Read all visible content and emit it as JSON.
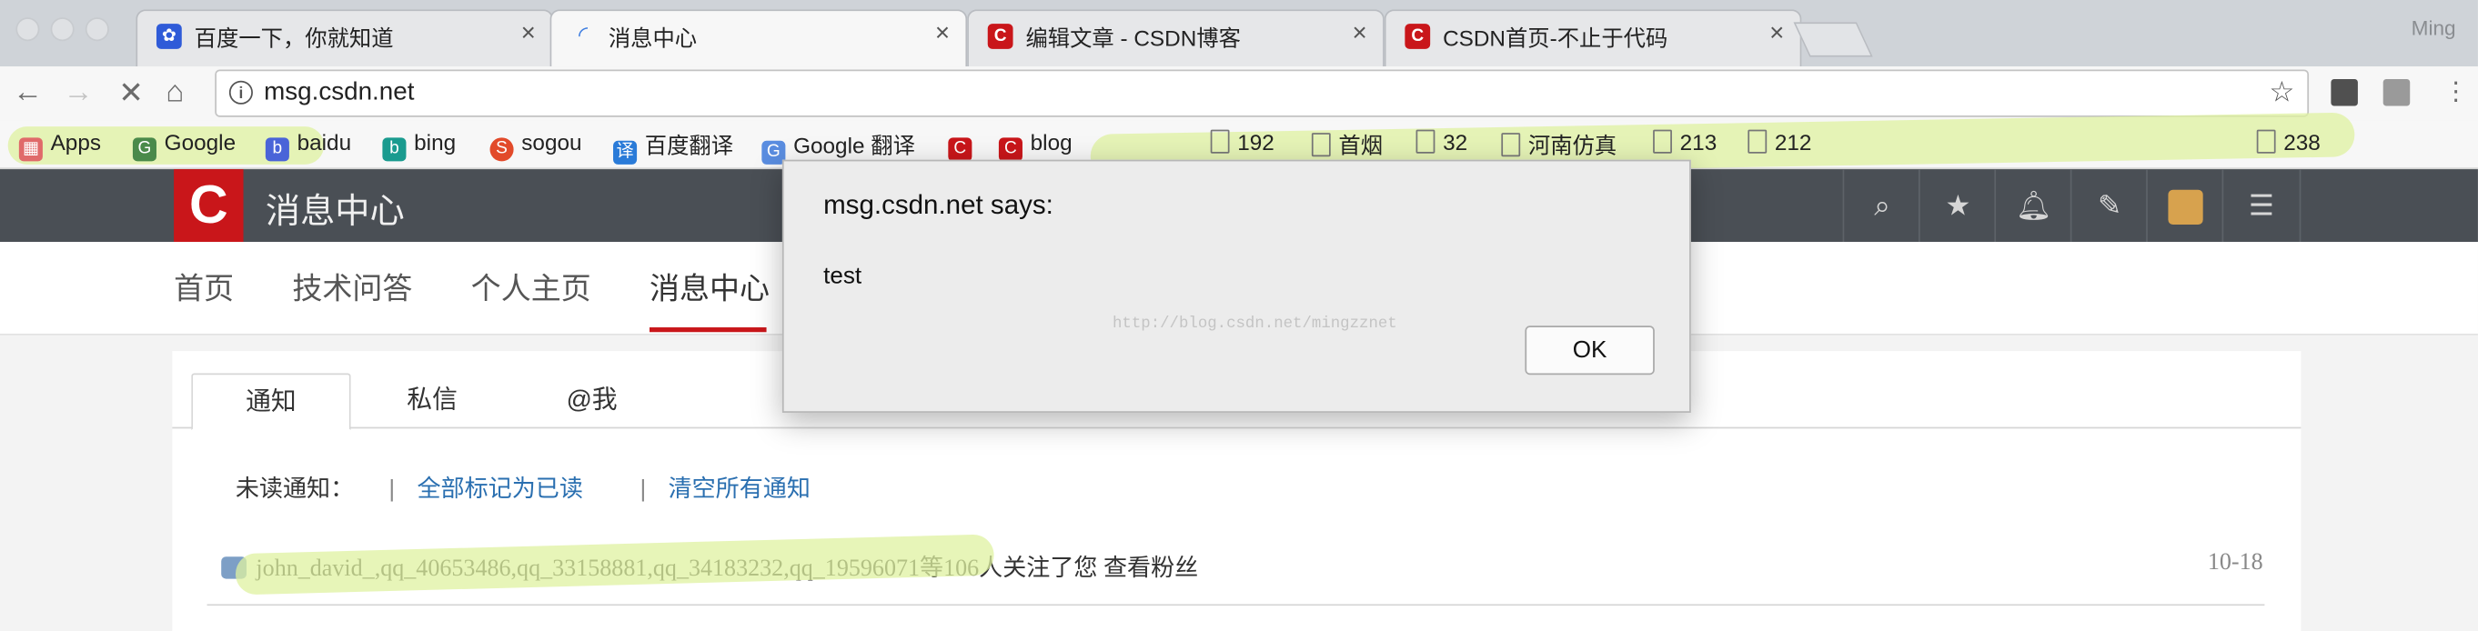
{
  "browser": {
    "tabs": [
      {
        "title": "百度一下，你就知道",
        "icon": "baidu-paw-icon",
        "color": "#2f5bd8"
      },
      {
        "title": "消息中心",
        "icon": "loading-spinner-icon",
        "color": "#3a7be0"
      },
      {
        "title": "编辑文章 - CSDN博客",
        "icon": "csdn-logo-icon",
        "color": "#c9161a"
      },
      {
        "title": "CSDN首页-不止于代码",
        "icon": "csdn-logo-icon",
        "color": "#c9161a"
      }
    ],
    "tab_close_glyph": "×",
    "profile_name": "Ming",
    "url": "msg.csdn.net",
    "bookmarks": [
      {
        "label": "Apps",
        "icon": "apps-grid-icon"
      },
      {
        "label": "Google",
        "icon": "google-icon"
      },
      {
        "label": "baidu",
        "icon": "baidu-icon"
      },
      {
        "label": "bing",
        "icon": "bing-icon"
      },
      {
        "label": "sogou",
        "icon": "sogou-icon"
      },
      {
        "label": "百度翻译",
        "icon": "baidu-translate-icon"
      },
      {
        "label": "Google 翻译",
        "icon": "google-translate-icon"
      },
      {
        "label": "",
        "icon": "csdn-logo-icon"
      },
      {
        "label": "blog",
        "icon": "csdn-logo-icon"
      },
      {
        "label": "192",
        "icon": "page-icon"
      },
      {
        "label": "首烟",
        "icon": "page-icon"
      },
      {
        "label": "32",
        "icon": "page-icon"
      },
      {
        "label": "河南仿真",
        "icon": "page-icon"
      },
      {
        "label": "213",
        "icon": "page-icon"
      },
      {
        "label": "212",
        "icon": "page-icon"
      },
      {
        "label": "238",
        "icon": "page-icon"
      }
    ]
  },
  "site": {
    "logo_letter": "C",
    "title": "消息中心",
    "nav": [
      "首页",
      "技术问答",
      "个人主页",
      "消息中心"
    ],
    "top_icons": [
      "search-icon",
      "star-icon",
      "bell-icon",
      "edit-icon",
      "avatar",
      "menu-icon"
    ],
    "panel_tabs": [
      "通知",
      "私信",
      "@我"
    ],
    "unread_label": "未读通知：",
    "separator": "|",
    "mark_all_read": "全部标记为已读",
    "clear_all": "清空所有通知",
    "notification": {
      "text": "john_david_,qq_40653486,qq_33158881,qq_34183232,qq_19596071等106人关注了您 查看粉丝",
      "date": "10-18"
    }
  },
  "dialog": {
    "title": "msg.csdn.net says:",
    "message": "test",
    "watermark": "http://blog.csdn.net/mingzznet",
    "ok_label": "OK"
  }
}
